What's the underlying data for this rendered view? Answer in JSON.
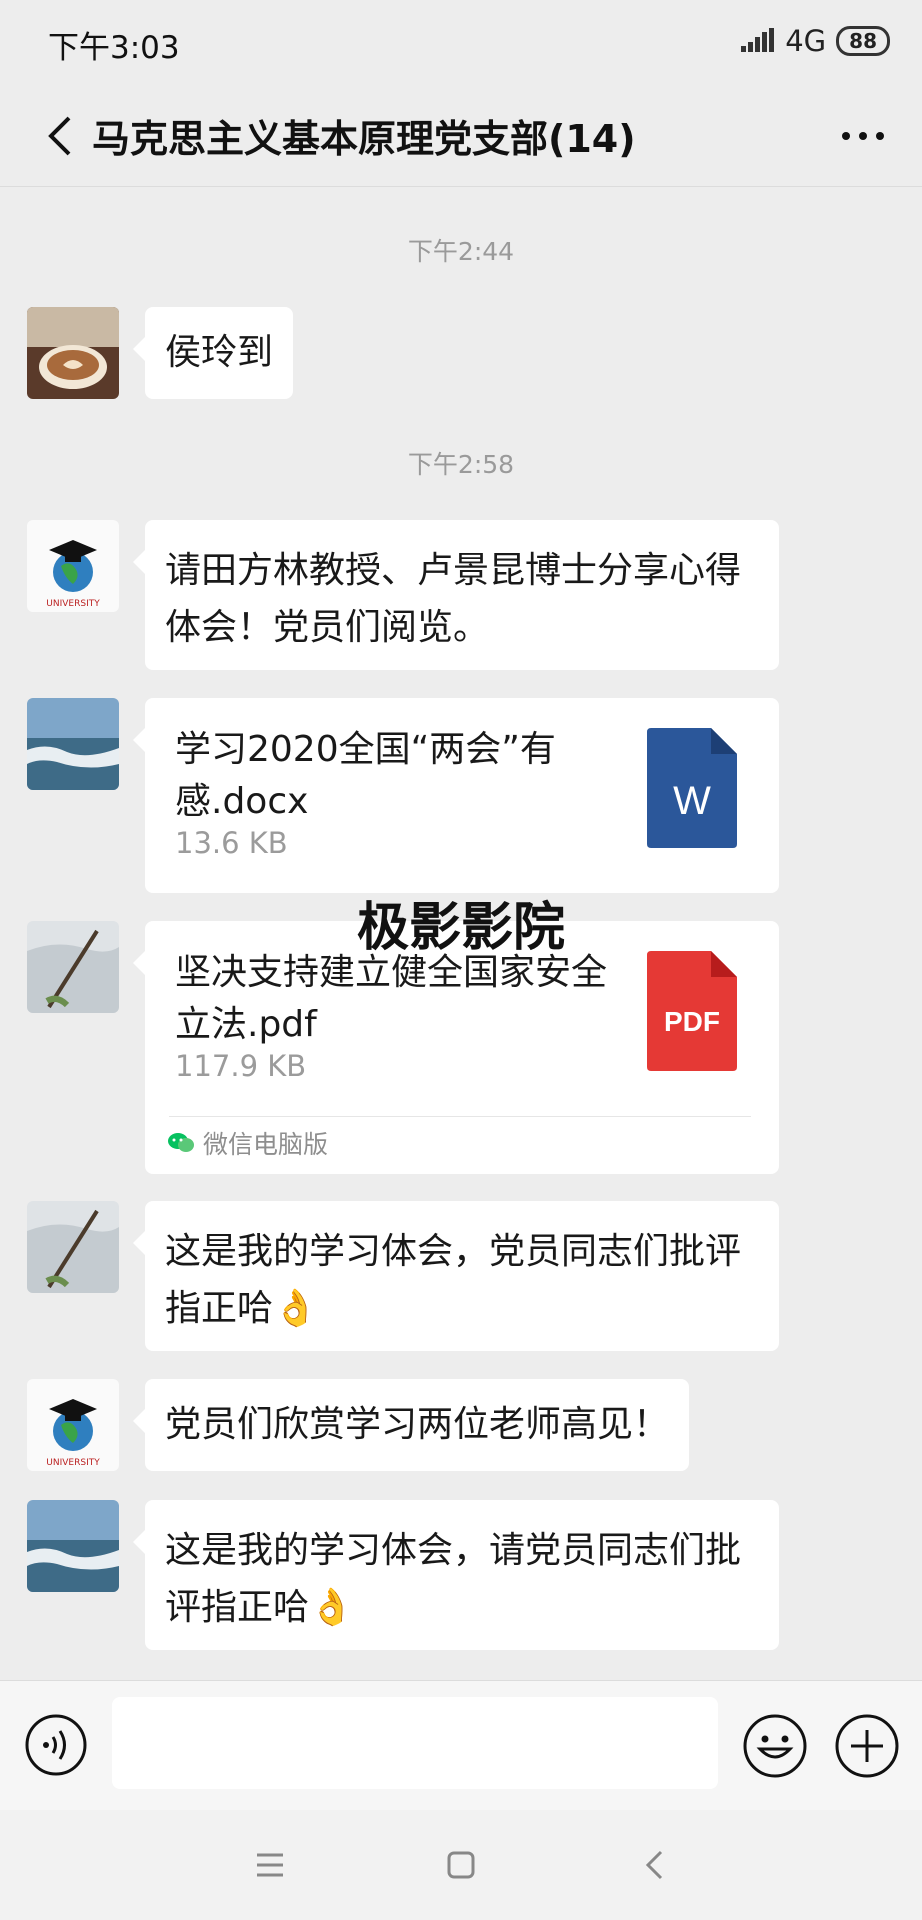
{
  "status_bar": {
    "time": "下午3:03",
    "network": "4G",
    "battery": "88"
  },
  "header": {
    "title": "马克思主义基本原理党支部(14)"
  },
  "timestamps": [
    "下午2:44",
    "下午2:58"
  ],
  "messages": [
    {
      "type": "text",
      "text": "侯玲到"
    },
    {
      "type": "text",
      "text": "请田方林教授、卢景昆博士分享心得体会！党员们阅览。"
    },
    {
      "type": "file",
      "name": "学习2020全国“两会”有感.docx",
      "size": "13.6 KB",
      "icon": "word-doc-icon",
      "icon_label": "W"
    },
    {
      "type": "file",
      "name": "坚决支持建立健全国家安全立法.pdf",
      "size": "117.9 KB",
      "icon": "pdf-icon",
      "icon_label": "PDF",
      "source": "微信电脑版"
    },
    {
      "type": "text",
      "text": "这是我的学习体会，党员同志们批评指正哈👌"
    },
    {
      "type": "text",
      "text": "党员们欣赏学习两位老师高见！"
    },
    {
      "type": "text",
      "text": "这是我的学习体会，请党员同志们批评指正哈👌"
    }
  ],
  "watermark": "极影影院",
  "colors": {
    "background": "#ededed",
    "word": "#2b579a",
    "pdf": "#e53935",
    "wechat_green": "#07c160"
  }
}
